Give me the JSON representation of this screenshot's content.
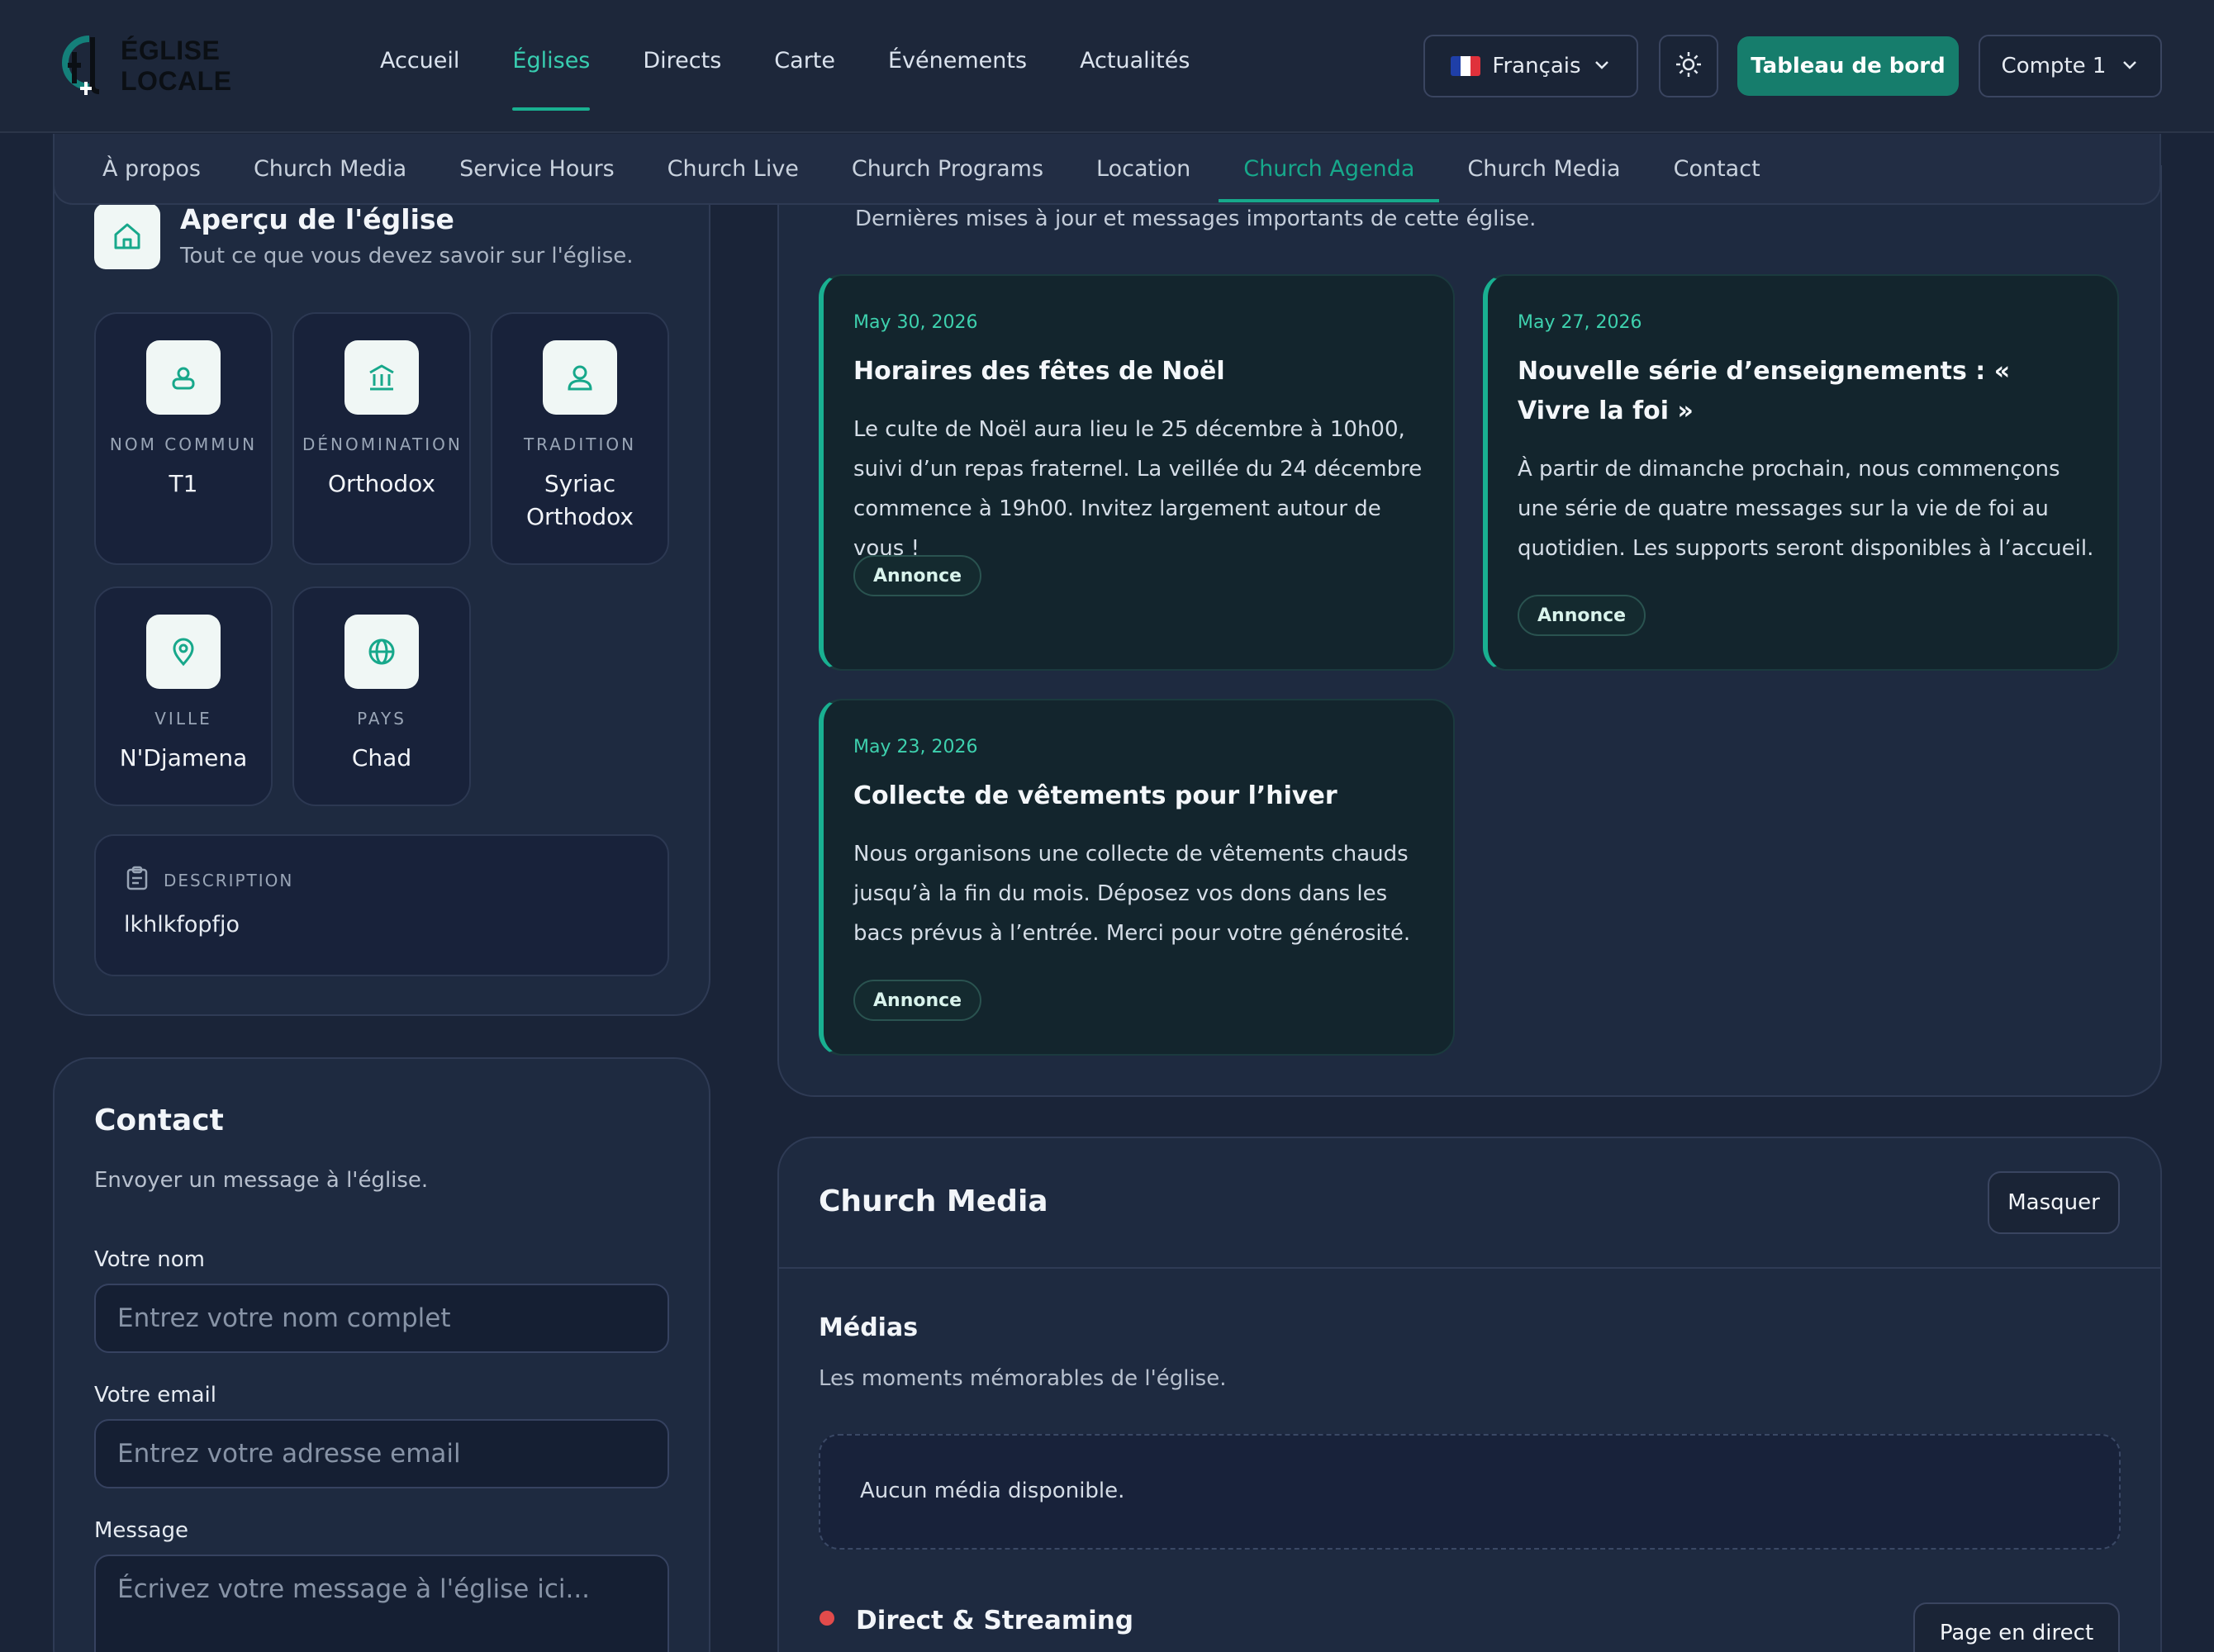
{
  "header": {
    "logo_text": "ÉGLISE LOCALE",
    "nav": [
      "Accueil",
      "Églises",
      "Directs",
      "Carte",
      "Événements",
      "Actualités"
    ],
    "active_nav": "Églises",
    "language": {
      "label": "Français",
      "flag": "flag-france-icon"
    },
    "theme_icon": "sun-icon",
    "dashboard_button": "Tableau de bord",
    "account": "Compte 1"
  },
  "subnav": {
    "items": [
      "À propos",
      "Church Media",
      "Service Hours",
      "Church Live",
      "Church Programs",
      "Location",
      "Church Agenda",
      "Church Media",
      "Contact"
    ],
    "active": "Church Agenda"
  },
  "overview": {
    "title": "Aperçu de l'église",
    "subtitle": "Tout ce que vous devez savoir sur l'église.",
    "icon": "home-icon",
    "stats": [
      {
        "label": "NOM COMMUN",
        "value": "T1",
        "icon": "user-badge-icon"
      },
      {
        "label": "DÉNOMINATION",
        "value": "Orthodox",
        "icon": "building-icon"
      },
      {
        "label": "TRADITION",
        "value": "Syriac Orthodox",
        "icon": "person-icon"
      },
      {
        "label": "VILLE",
        "value": "N'Djamena",
        "icon": "map-pin-icon"
      },
      {
        "label": "PAYS",
        "value": "Chad",
        "icon": "globe-icon"
      }
    ],
    "description": {
      "label": "DESCRIPTION",
      "value": "lkhlkfopfjo",
      "icon": "clipboard-icon"
    }
  },
  "contact": {
    "title": "Contact",
    "subtitle": "Envoyer un message à l'église.",
    "name_label": "Votre nom",
    "name_placeholder": "Entrez votre nom complet",
    "email_label": "Votre email",
    "email_placeholder": "Entrez votre adresse email",
    "message_label": "Message",
    "message_placeholder": "Écrivez votre message à l'église ici..."
  },
  "news": {
    "subtitle": "Dernières mises à jour et messages importants de cette église.",
    "cards": [
      {
        "date": "May 30, 2026",
        "title": "Horaires des fêtes de Noël",
        "body": "Le culte de Noël aura lieu le 25 décembre à 10h00, suivi d’un repas fraternel. La veillée du 24 décembre commence à 19h00. Invitez largement autour de vous !",
        "badge": "Annonce"
      },
      {
        "date": "May 27, 2026",
        "title": "Nouvelle série d’enseignements : « Vivre la foi »",
        "body": "À partir de dimanche prochain, nous commençons une série de quatre messages sur la vie de foi au quotidien. Les supports seront disponibles à l’accueil.",
        "badge": "Annonce"
      },
      {
        "date": "May 23, 2026",
        "title": "Collecte de vêtements pour l’hiver",
        "body": "Nous organisons une collecte de vêtements chauds jusqu’à la fin du mois. Déposez vos dons dans les bacs prévus à l’entrée. Merci pour votre générosité.",
        "badge": "Annonce"
      }
    ]
  },
  "media": {
    "title": "Church Media",
    "hide_button": "Masquer",
    "medias_title": "Médias",
    "medias_subtitle": "Les moments mémorables de l'église.",
    "empty_text": "Aucun média disponible.",
    "live_title": "Direct & Streaming",
    "live_button": "Page en direct"
  },
  "colors": {
    "accent": "#19b091",
    "background": "#1a2438",
    "card": "#1e2a40",
    "live": "#e24b4b"
  }
}
